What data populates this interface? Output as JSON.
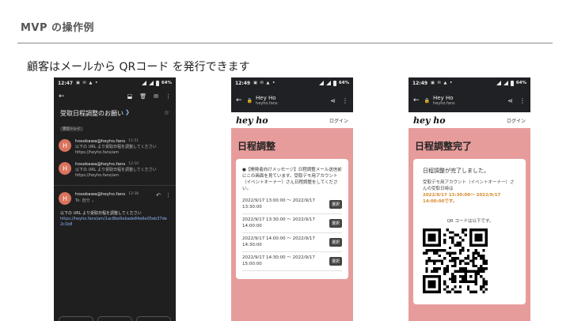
{
  "slide": {
    "title": "MVP の操作例",
    "subtitle": "顧客はメールから QRコード を発行できます"
  },
  "gmail": {
    "status_time": "12:47",
    "status_glyphs": "▣ ✉ ▲ •",
    "battery": "64%",
    "subject": "受取日程調整のお願い",
    "label_badge": "受信トレイ",
    "messages": [
      {
        "avatar": "H",
        "sender": "hosokawa@heyho.fans",
        "time": "11:51",
        "preview": "以下の URL より受取日程を調整してください https://heyho.fans/am"
      },
      {
        "avatar": "H",
        "sender": "hosokawa@heyho.fans",
        "time": "12:10",
        "preview": "以下の URL より受取日程を調整してください https://heyho.fans/am"
      }
    ],
    "open_message": {
      "avatar": "H",
      "sender": "hosokawa@heyho.fans",
      "time": "12:38",
      "to": "To: 自分 ⌄"
    },
    "body_text": "以下の URL より受取日程を調整してください",
    "body_link": "https://heyho.fans/am/1ac8be9ebade84a6e05eb37de2c1b8"
  },
  "schedule_page": {
    "status_time": "12:49",
    "status_glyphs": "▣ ✉ ▲ •",
    "battery": "64%",
    "tab_title": "Hey Ho",
    "domain": "heyho.fans",
    "logo": "hey ho",
    "login": "ログイン",
    "heading": "日程調整",
    "notice": "●【開発者向けメッセージ】日程調整メール送信前にこの画面を見ています。受取デモ用アカウント（イベントオーナー）さん日程調整をしてください。",
    "select_label": "選択",
    "slots": [
      "2022/9/17 13:00:00 〜 2022/9/17 13:30:00",
      "2022/9/17 13:30:00 〜 2022/9/17 14:00:00",
      "2022/9/17 14:00:00 〜 2022/9/17 14:30:00",
      "2022/9/17 14:30:00 〜 2022/9/17 15:00:00"
    ]
  },
  "done_page": {
    "status_time": "12:49",
    "status_glyphs": "▣ ✉ ▲ •",
    "battery": "64%",
    "tab_title": "Hey Ho",
    "domain": "heyho.fans",
    "logo": "hey ho",
    "login": "ログイン",
    "heading": "日程調整完了",
    "done_message": "日程調整が完了しました。",
    "desc": "受取デモ用アカウント（イベントオーナー）さんの受取日時は",
    "date_range": "2022/9/17 13:30:00〜 2022/9/17 14:00:00です。",
    "qr_label": "QR コードは以下です。"
  }
}
